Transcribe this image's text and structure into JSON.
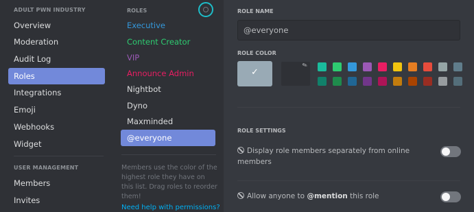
{
  "sidebar": {
    "server_name": "ADULT PWN INDUSTRY",
    "items": [
      {
        "label": "Overview"
      },
      {
        "label": "Moderation"
      },
      {
        "label": "Audit Log"
      },
      {
        "label": "Roles",
        "active": true
      },
      {
        "label": "Integrations"
      },
      {
        "label": "Emoji"
      },
      {
        "label": "Webhooks"
      },
      {
        "label": "Widget"
      }
    ],
    "user_management_header": "USER MANAGEMENT",
    "user_items": [
      {
        "label": "Members"
      },
      {
        "label": "Invites"
      }
    ]
  },
  "roles_panel": {
    "header": "ROLES",
    "add_icon": "plus-circle-icon",
    "roles": [
      {
        "name": "Executive",
        "color": "#3498db"
      },
      {
        "name": "Content Creator",
        "color": "#2ecc71"
      },
      {
        "name": "VIP",
        "color": "#9b59b6"
      },
      {
        "name": "Announce Admin",
        "color": "#e91e63"
      },
      {
        "name": "Nightbot",
        "color": "#dcddde"
      },
      {
        "name": "Dyno",
        "color": "#dcddde"
      },
      {
        "name": "Maxminded",
        "color": "#dcddde"
      },
      {
        "name": "@everyone",
        "color": "#ffffff",
        "active": true
      }
    ],
    "help_text": "Members use the color of the highest role they have on this list. Drag roles to reorder them!",
    "help_link": "Need help with permissions?"
  },
  "main": {
    "role_name_label": "ROLE NAME",
    "role_name_value": "@everyone",
    "role_color_label": "ROLE COLOR",
    "default_color": "#99aab5",
    "picker_icon": "eyedropper-icon",
    "checkmark_icon": "checkmark-icon",
    "swatch_colors_top": [
      "#1abc9c",
      "#2ecc71",
      "#3498db",
      "#9b59b6",
      "#e91e63",
      "#f1c40f",
      "#e67e22",
      "#e74c3c",
      "#95a5a6",
      "#607d8b"
    ],
    "swatch_colors_bottom": [
      "#11806a",
      "#1f8b4c",
      "#206694",
      "#71368a",
      "#ad1457",
      "#c27c0e",
      "#a84300",
      "#992d22",
      "#979c9f",
      "#546e7a"
    ],
    "role_settings_label": "ROLE SETTINGS",
    "settings": [
      {
        "text_line1": "Display role members separately from online",
        "text_line2": "members",
        "enabled": false
      },
      {
        "prefix": "Allow anyone to ",
        "bold": "@mention",
        "suffix": " this role",
        "enabled": false
      }
    ]
  }
}
